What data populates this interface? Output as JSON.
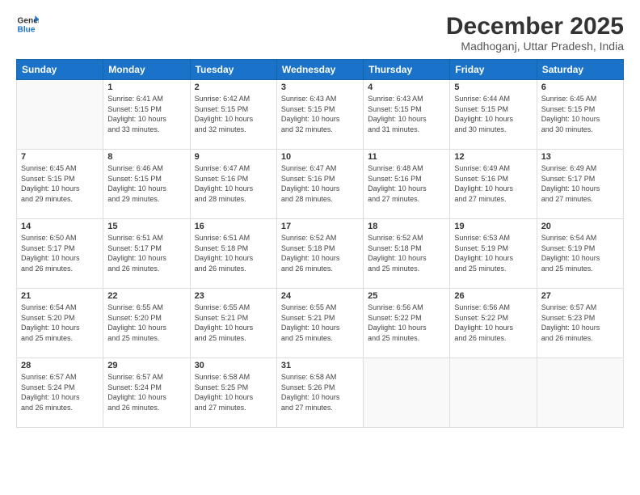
{
  "header": {
    "logo_line1": "General",
    "logo_line2": "Blue",
    "month": "December 2025",
    "location": "Madhoganj, Uttar Pradesh, India"
  },
  "weekdays": [
    "Sunday",
    "Monday",
    "Tuesday",
    "Wednesday",
    "Thursday",
    "Friday",
    "Saturday"
  ],
  "weeks": [
    [
      {
        "day": "",
        "info": ""
      },
      {
        "day": "1",
        "info": "Sunrise: 6:41 AM\nSunset: 5:15 PM\nDaylight: 10 hours\nand 33 minutes."
      },
      {
        "day": "2",
        "info": "Sunrise: 6:42 AM\nSunset: 5:15 PM\nDaylight: 10 hours\nand 32 minutes."
      },
      {
        "day": "3",
        "info": "Sunrise: 6:43 AM\nSunset: 5:15 PM\nDaylight: 10 hours\nand 32 minutes."
      },
      {
        "day": "4",
        "info": "Sunrise: 6:43 AM\nSunset: 5:15 PM\nDaylight: 10 hours\nand 31 minutes."
      },
      {
        "day": "5",
        "info": "Sunrise: 6:44 AM\nSunset: 5:15 PM\nDaylight: 10 hours\nand 30 minutes."
      },
      {
        "day": "6",
        "info": "Sunrise: 6:45 AM\nSunset: 5:15 PM\nDaylight: 10 hours\nand 30 minutes."
      }
    ],
    [
      {
        "day": "7",
        "info": "Sunrise: 6:45 AM\nSunset: 5:15 PM\nDaylight: 10 hours\nand 29 minutes."
      },
      {
        "day": "8",
        "info": "Sunrise: 6:46 AM\nSunset: 5:15 PM\nDaylight: 10 hours\nand 29 minutes."
      },
      {
        "day": "9",
        "info": "Sunrise: 6:47 AM\nSunset: 5:16 PM\nDaylight: 10 hours\nand 28 minutes."
      },
      {
        "day": "10",
        "info": "Sunrise: 6:47 AM\nSunset: 5:16 PM\nDaylight: 10 hours\nand 28 minutes."
      },
      {
        "day": "11",
        "info": "Sunrise: 6:48 AM\nSunset: 5:16 PM\nDaylight: 10 hours\nand 27 minutes."
      },
      {
        "day": "12",
        "info": "Sunrise: 6:49 AM\nSunset: 5:16 PM\nDaylight: 10 hours\nand 27 minutes."
      },
      {
        "day": "13",
        "info": "Sunrise: 6:49 AM\nSunset: 5:17 PM\nDaylight: 10 hours\nand 27 minutes."
      }
    ],
    [
      {
        "day": "14",
        "info": "Sunrise: 6:50 AM\nSunset: 5:17 PM\nDaylight: 10 hours\nand 26 minutes."
      },
      {
        "day": "15",
        "info": "Sunrise: 6:51 AM\nSunset: 5:17 PM\nDaylight: 10 hours\nand 26 minutes."
      },
      {
        "day": "16",
        "info": "Sunrise: 6:51 AM\nSunset: 5:18 PM\nDaylight: 10 hours\nand 26 minutes."
      },
      {
        "day": "17",
        "info": "Sunrise: 6:52 AM\nSunset: 5:18 PM\nDaylight: 10 hours\nand 26 minutes."
      },
      {
        "day": "18",
        "info": "Sunrise: 6:52 AM\nSunset: 5:18 PM\nDaylight: 10 hours\nand 25 minutes."
      },
      {
        "day": "19",
        "info": "Sunrise: 6:53 AM\nSunset: 5:19 PM\nDaylight: 10 hours\nand 25 minutes."
      },
      {
        "day": "20",
        "info": "Sunrise: 6:54 AM\nSunset: 5:19 PM\nDaylight: 10 hours\nand 25 minutes."
      }
    ],
    [
      {
        "day": "21",
        "info": "Sunrise: 6:54 AM\nSunset: 5:20 PM\nDaylight: 10 hours\nand 25 minutes."
      },
      {
        "day": "22",
        "info": "Sunrise: 6:55 AM\nSunset: 5:20 PM\nDaylight: 10 hours\nand 25 minutes."
      },
      {
        "day": "23",
        "info": "Sunrise: 6:55 AM\nSunset: 5:21 PM\nDaylight: 10 hours\nand 25 minutes."
      },
      {
        "day": "24",
        "info": "Sunrise: 6:55 AM\nSunset: 5:21 PM\nDaylight: 10 hours\nand 25 minutes."
      },
      {
        "day": "25",
        "info": "Sunrise: 6:56 AM\nSunset: 5:22 PM\nDaylight: 10 hours\nand 25 minutes."
      },
      {
        "day": "26",
        "info": "Sunrise: 6:56 AM\nSunset: 5:22 PM\nDaylight: 10 hours\nand 26 minutes."
      },
      {
        "day": "27",
        "info": "Sunrise: 6:57 AM\nSunset: 5:23 PM\nDaylight: 10 hours\nand 26 minutes."
      }
    ],
    [
      {
        "day": "28",
        "info": "Sunrise: 6:57 AM\nSunset: 5:24 PM\nDaylight: 10 hours\nand 26 minutes."
      },
      {
        "day": "29",
        "info": "Sunrise: 6:57 AM\nSunset: 5:24 PM\nDaylight: 10 hours\nand 26 minutes."
      },
      {
        "day": "30",
        "info": "Sunrise: 6:58 AM\nSunset: 5:25 PM\nDaylight: 10 hours\nand 27 minutes."
      },
      {
        "day": "31",
        "info": "Sunrise: 6:58 AM\nSunset: 5:26 PM\nDaylight: 10 hours\nand 27 minutes."
      },
      {
        "day": "",
        "info": ""
      },
      {
        "day": "",
        "info": ""
      },
      {
        "day": "",
        "info": ""
      }
    ]
  ]
}
